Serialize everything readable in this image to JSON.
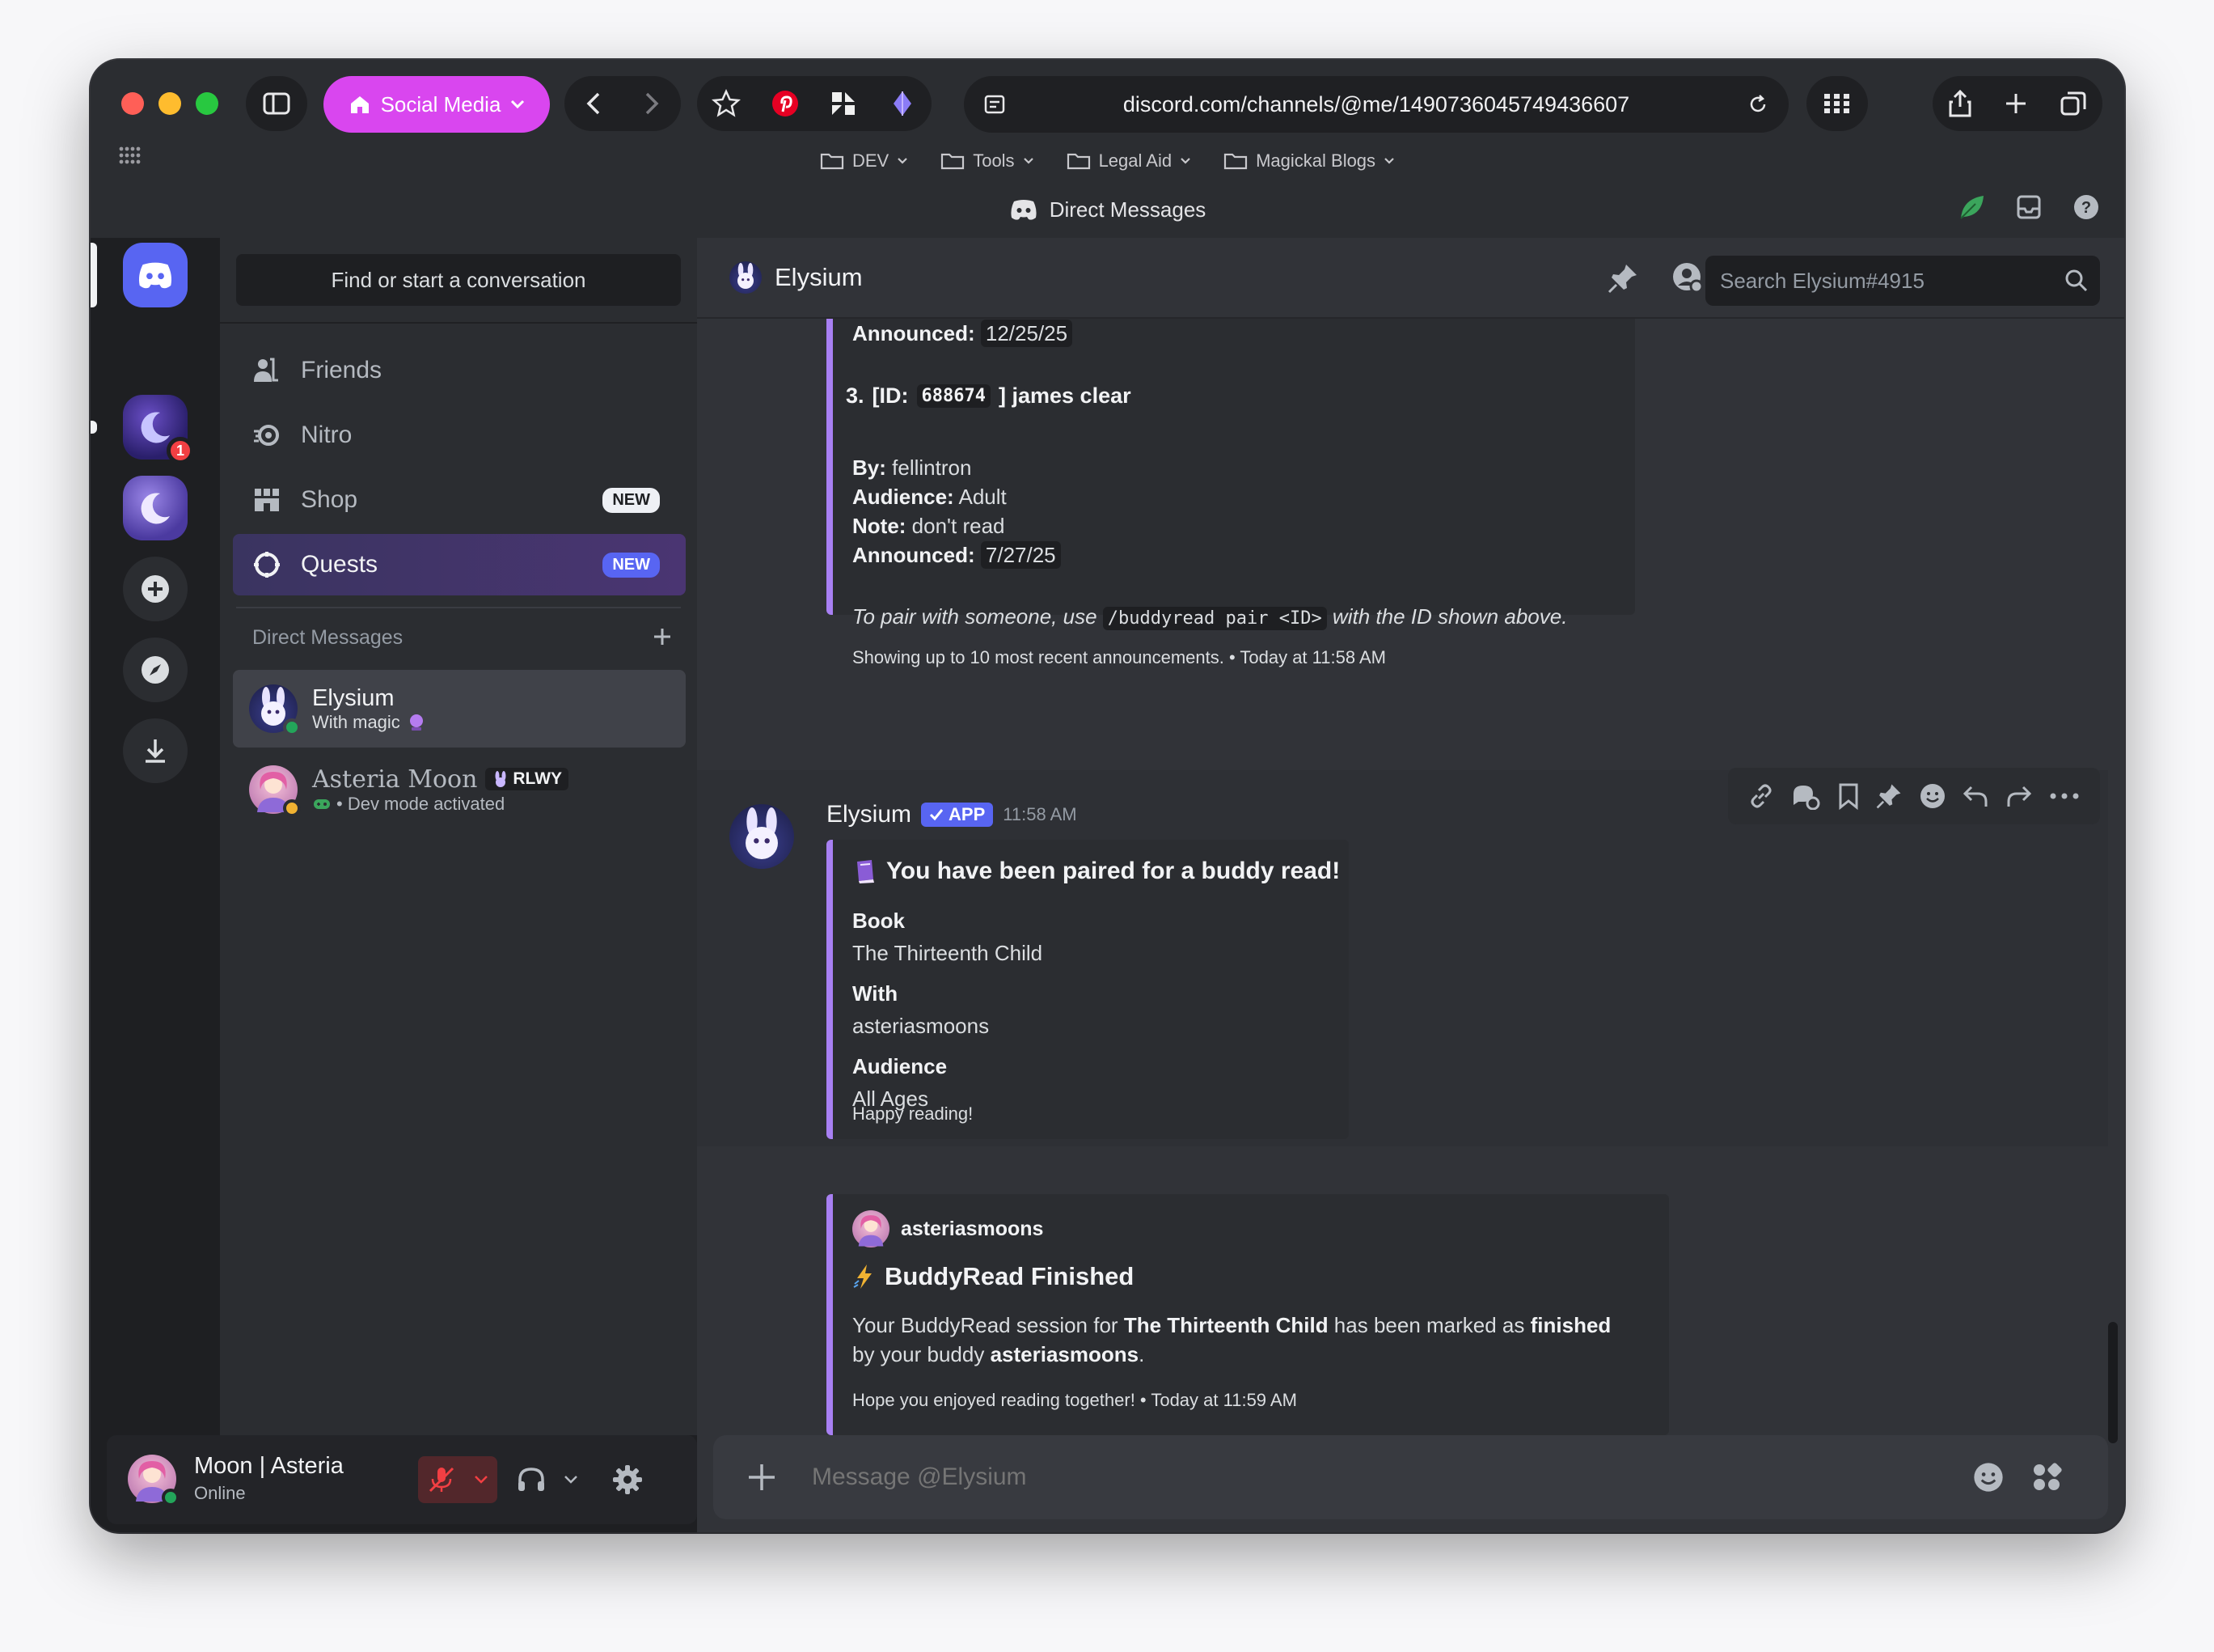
{
  "browser": {
    "tab_group_label": "Social Media",
    "url": "discord.com/channels/@me/1490736045749436607",
    "bookmarks": [
      "DEV",
      "Tools",
      "Legal Aid",
      "Magickal Blogs"
    ],
    "window_title": "Direct Messages"
  },
  "sidebar": {
    "find_placeholder": "Find or start a conversation",
    "nav": [
      {
        "label": "Friends"
      },
      {
        "label": "Nitro"
      },
      {
        "label": "Shop",
        "badge": "NEW"
      },
      {
        "label": "Quests",
        "badge": "NEW"
      }
    ],
    "server_badge": "1",
    "dm_header": "Direct Messages",
    "dms": [
      {
        "name": "Elysium",
        "status_text": "With magic"
      },
      {
        "name": "Asteria Moon",
        "tag": "RLWY",
        "status_text": "• Dev mode activated"
      }
    ]
  },
  "user_panel": {
    "name": "Moon | Asteria",
    "status": "Online"
  },
  "channel": {
    "name": "Elysium",
    "search_placeholder": "Search Elysium#4915",
    "composer_placeholder": "Message @Elysium"
  },
  "embed1": {
    "announced_label": "Announced:",
    "announced_top": "12/25/25",
    "item3_num": "3.",
    "item3_id_label": "[ID:",
    "item3_id": "688674",
    "item3_title": "] james clear",
    "by_label": "By:",
    "by": "fellintron",
    "audience_label": "Audience:",
    "audience": "Adult",
    "note_label": "Note:",
    "note": "don't read",
    "announced": "7/27/25",
    "pair_prefix": "To pair with someone, use",
    "pair_cmd": "/buddyread pair <ID>",
    "pair_suffix": "with the ID shown above.",
    "footer": "Showing up to 10 most recent announcements. • Today at 11:58 AM"
  },
  "message": {
    "author": "Elysium",
    "app_badge": "APP",
    "time": "11:58 AM"
  },
  "embed2": {
    "title": "You have been paired for a buddy read!",
    "book_label": "Book",
    "book": "The Thirteenth Child",
    "with_label": "With",
    "with": "asteriasmoons",
    "audience_label": "Audience",
    "audience": "All Ages",
    "footer": "Happy reading!"
  },
  "embed3": {
    "author": "asteriasmoons",
    "title": "BuddyRead Finished",
    "t1": "Your BuddyRead session for ",
    "t2": "The Thirteenth Child",
    "t3": " has been marked as ",
    "t4": "finished",
    "t5": "by your buddy ",
    "t6": "asteriasmoons",
    "t7": ".",
    "footer": "Hope you enjoyed reading together! • Today at 11:59 AM"
  },
  "colors": {
    "accent": "#5865f2",
    "embed_border": "#a880f3",
    "online": "#23a55a",
    "tab_group": "#d946ef"
  }
}
